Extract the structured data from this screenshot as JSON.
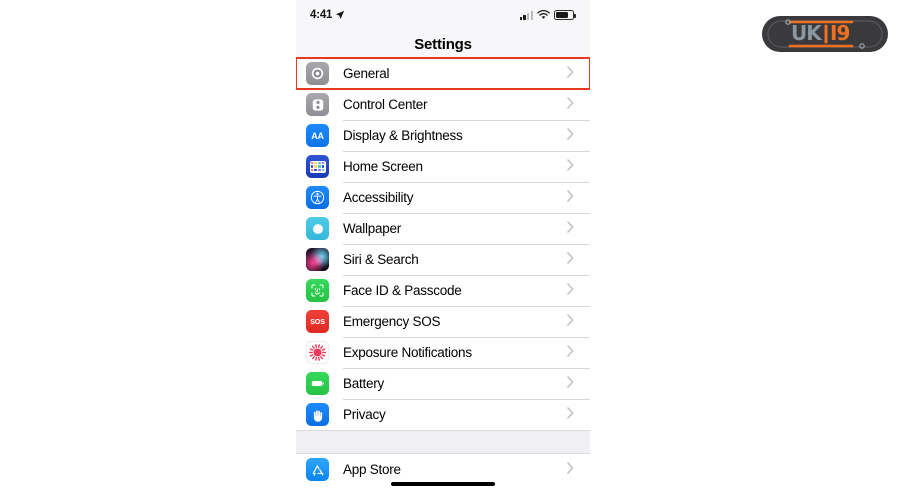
{
  "statusbar": {
    "time": "4:41",
    "location_icon": "location-arrow-icon",
    "signal_icon": "cellular-signal-icon",
    "wifi_icon": "wifi-icon",
    "battery_icon": "battery-icon"
  },
  "nav": {
    "title": "Settings"
  },
  "highlight": {
    "color": "#e8391f",
    "target": "General"
  },
  "groups": [
    {
      "items": [
        {
          "label": "General",
          "icon": "gear-icon",
          "icon_class": "ic-general",
          "highlighted": true
        },
        {
          "label": "Control Center",
          "icon": "sliders-icon",
          "icon_class": "ic-control",
          "highlighted": false
        },
        {
          "label": "Display & Brightness",
          "icon": "aa-text-size-icon",
          "icon_class": "ic-display",
          "highlighted": false
        },
        {
          "label": "Home Screen",
          "icon": "app-grid-icon",
          "icon_class": "ic-home",
          "highlighted": false
        },
        {
          "label": "Accessibility",
          "icon": "accessibility-icon",
          "icon_class": "ic-access",
          "highlighted": false
        },
        {
          "label": "Wallpaper",
          "icon": "flower-icon",
          "icon_class": "ic-wall",
          "highlighted": false
        },
        {
          "label": "Siri & Search",
          "icon": "siri-orb-icon",
          "icon_class": "ic-siri",
          "highlighted": false
        },
        {
          "label": "Face ID & Passcode",
          "icon": "face-id-icon",
          "icon_class": "ic-faceid",
          "highlighted": false
        },
        {
          "label": "Emergency SOS",
          "icon": "sos-icon",
          "icon_class": "ic-sos",
          "highlighted": false
        },
        {
          "label": "Exposure Notifications",
          "icon": "exposure-dot-icon",
          "icon_class": "ic-exposure",
          "highlighted": false
        },
        {
          "label": "Battery",
          "icon": "battery-icon",
          "icon_class": "ic-battery",
          "highlighted": false
        },
        {
          "label": "Privacy",
          "icon": "hand-icon",
          "icon_class": "ic-privacy",
          "highlighted": false
        }
      ]
    },
    {
      "items": [
        {
          "label": "App Store",
          "icon": "app-store-icon",
          "icon_class": "ic-appstore",
          "highlighted": false
        }
      ]
    }
  ],
  "chevron_icon": "chevron-right-icon",
  "home_indicator": "home-indicator-bar",
  "logo": {
    "name": "site-watermark-logo",
    "text": "UKI9",
    "body_color": "#3a3a3c",
    "accent_color": "#f07020",
    "text_color": "#8a96a0"
  }
}
